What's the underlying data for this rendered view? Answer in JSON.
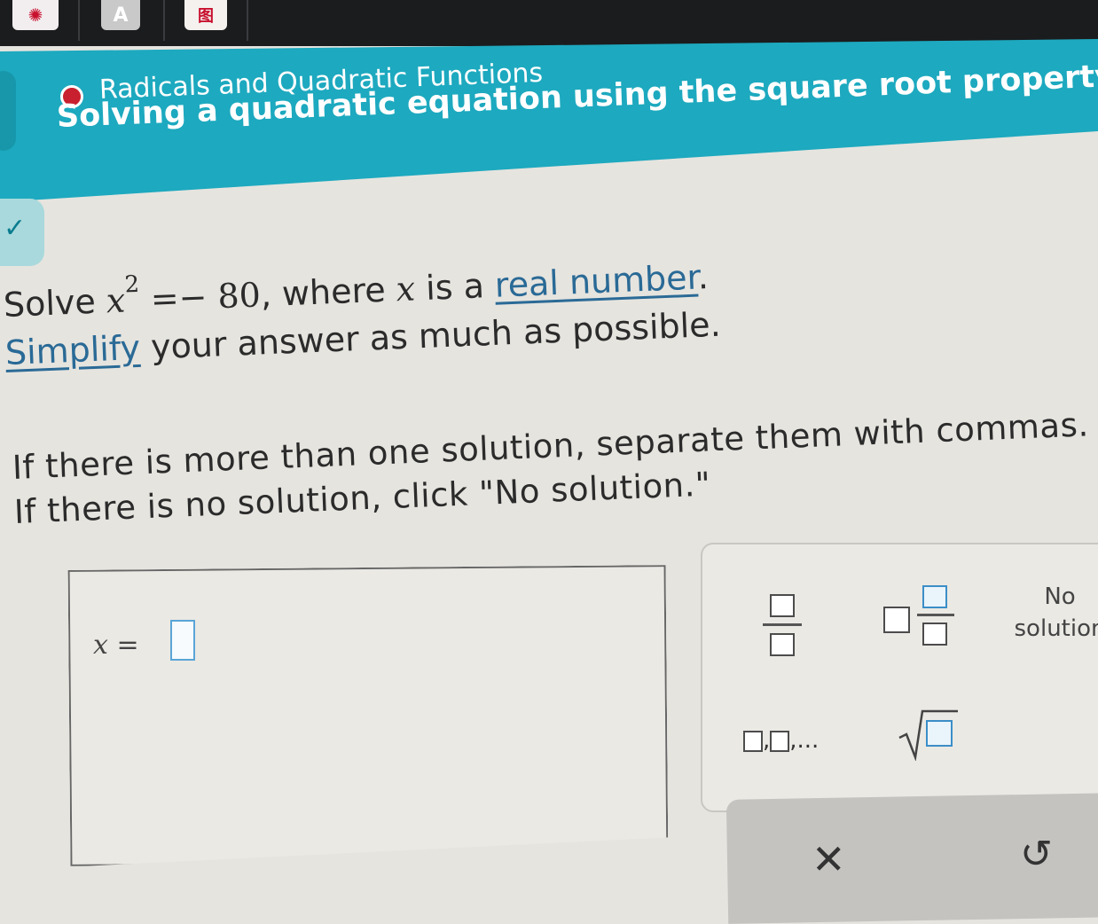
{
  "browser": {
    "tab_icons": [
      {
        "label": ""
      },
      {
        "label": "A"
      },
      {
        "label": "图"
      }
    ]
  },
  "header": {
    "topic": "Radicals and Quadratic Functions",
    "title": "Solving a quadratic equation using the square root property: Exact..."
  },
  "problem": {
    "solve_prefix": "Solve ",
    "var": "x",
    "exponent": "2",
    "rhs": " =− 80",
    "where_text": ", where ",
    "var2": "x",
    "is_a": " is a ",
    "real_number_link": "real number",
    "period": ".",
    "simplify_link": "Simplify",
    "simplify_rest": " your answer as much as possible.",
    "instruction_1": "If there is more than one solution, separate them with commas.",
    "instruction_2": "If there is no solution, click \"No solution.\""
  },
  "answer": {
    "label_var": "x",
    "label_eq": " = "
  },
  "keypad": {
    "no_solution_line1": "No",
    "no_solution_line2": "solution",
    "list_suffix": ",...",
    "list_comma": ","
  },
  "actions": {
    "clear_symbol": "✕",
    "undo_symbol": "↺"
  },
  "colors": {
    "header_teal": "#1da9bf",
    "status_dot": "#c8202e",
    "link_blue": "#2a6a96",
    "input_border": "#5aa5d6"
  }
}
